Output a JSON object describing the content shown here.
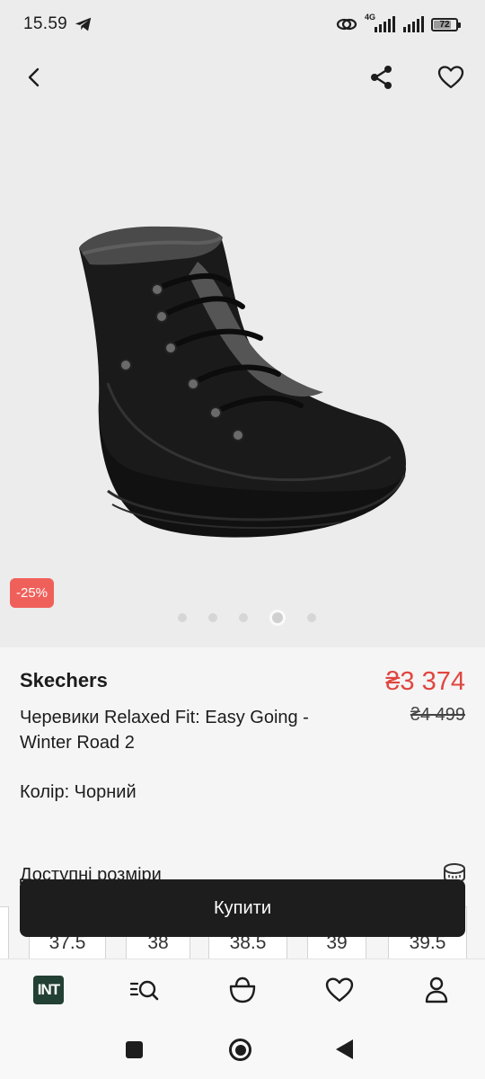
{
  "status_bar": {
    "time": "15.59",
    "network": "4G",
    "battery": "72"
  },
  "product": {
    "brand": "Skechers",
    "name": "Черевики Relaxed Fit: Easy Going - Winter Road 2",
    "price_current": "₴3 374",
    "price_old": "₴4 499",
    "discount": "-25%",
    "color_text": "Колір: Чорний",
    "gallery": {
      "total_images": 5,
      "active_index": 4
    }
  },
  "sizes": {
    "title": "Доступні розміри",
    "items": [
      "37.5",
      "38",
      "38.5",
      "39",
      "39.5"
    ]
  },
  "buy_button": {
    "label": "Купити"
  },
  "bottom_nav": {
    "logo_text": "INT",
    "items": [
      "logo-icon",
      "search-catalog-icon",
      "bag-icon",
      "heart-icon",
      "profile-icon"
    ]
  },
  "colors": {
    "accent_price": "#e0463f",
    "discount_badge": "#f0605a",
    "logo_bg": "#234034",
    "button_bg": "#1d1d1d"
  }
}
